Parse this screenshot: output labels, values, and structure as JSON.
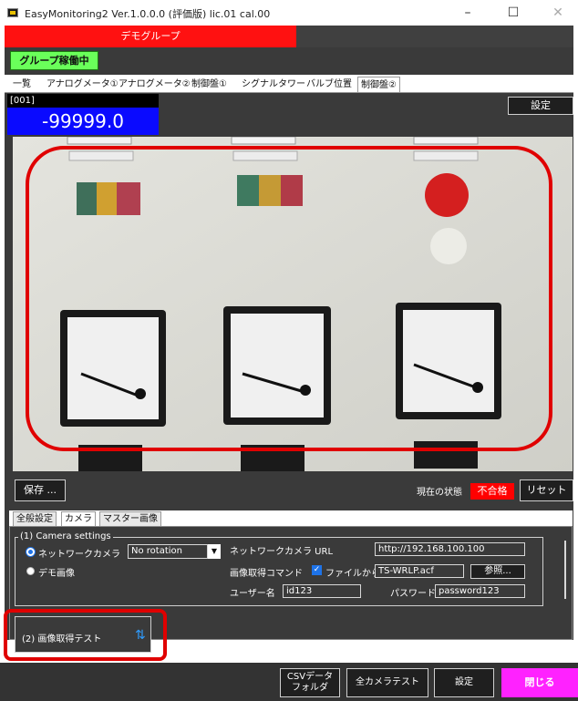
{
  "window": {
    "title": "EasyMonitoring2 Ver.1.0.0.0 (評価版) lic.01 cal.00",
    "minimize_glyph": "–",
    "maximize_glyph": "☐",
    "close_glyph": "✕"
  },
  "group": {
    "tab_label": "デモグループ",
    "status_button": "グループ稼働中"
  },
  "tabs": [
    {
      "label": "一覧"
    },
    {
      "label": "アナログメータ①"
    },
    {
      "label": "アナログメータ②"
    },
    {
      "label": "制御盤①"
    },
    {
      "label": "シグナルタワー"
    },
    {
      "label": "バルブ位置"
    },
    {
      "label": "制御盤②"
    }
  ],
  "meter": {
    "id": "[001]",
    "value": "-99999.0",
    "settings_button": "設定"
  },
  "camera_controls": {
    "save_button": "保存 ...",
    "state_label": "現在の状態",
    "state_value": "不合格",
    "reset_button": "リセット"
  },
  "subtabs": [
    {
      "label": "全般設定"
    },
    {
      "label": "カメラ"
    },
    {
      "label": "マスター画像"
    }
  ],
  "camera_settings": {
    "section_title": "(1) Camera settings",
    "source_network": "ネットワークカメラ",
    "source_demo": "デモ画像",
    "rotation_value": "No rotation",
    "url_label": "ネットワークカメラ URL",
    "url_value": "http://192.168.100.100",
    "command_label": "画像取得コマンド",
    "from_file_label": "ファイルから",
    "command_value": "TS-WRLP.acf",
    "browse_button": "参照...",
    "user_label": "ユーザー名",
    "user_value": "id123",
    "password_label": "パスワード",
    "password_value": "password123"
  },
  "image_test": {
    "label": "(2) 画像取得テスト"
  },
  "footer": {
    "csv_button": "CSVデータ\nフォルダ",
    "all_camera_test": "全カメラテスト",
    "settings": "設定",
    "close": "閉じる"
  },
  "colors": {
    "accent_red": "#ff1111",
    "active_green": "#6aff5a",
    "value_blue": "#0a0aff",
    "close_magenta": "#ff22ff",
    "highlight_red": "#e00000"
  }
}
